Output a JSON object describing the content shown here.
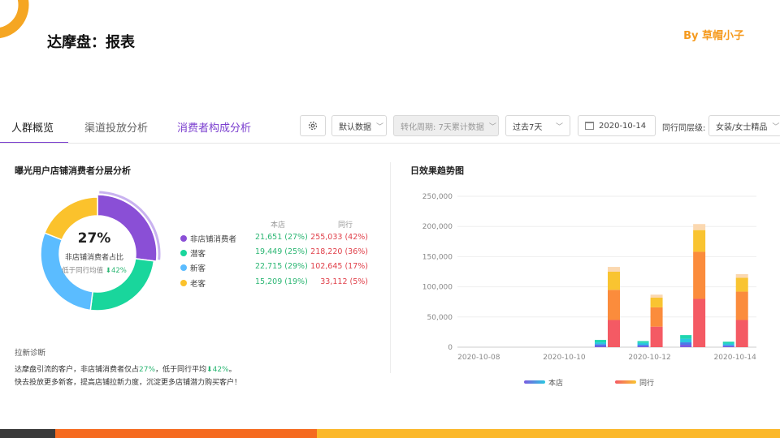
{
  "slide": {
    "title": "达摩盘：报表",
    "byline": "By 草帽小子"
  },
  "tabs": [
    {
      "label": "人群概览",
      "active": true
    },
    {
      "label": "渠道投放分析",
      "active": false
    },
    {
      "label": "消费者构成分析",
      "active": false
    }
  ],
  "toolbar": {
    "settings_icon": "gear-icon",
    "data_source": "默认数据",
    "conversion_period": "转化周期: 7天累计数据",
    "range": "过去7天",
    "date": "2020-10-14",
    "peer_label": "同行同层级:",
    "peer_category": "女装/女士精品"
  },
  "consumer_panel": {
    "title": "曝光用户店铺消费者分层分析",
    "center_value": "27%",
    "center_label": "非店铺消费者占比",
    "compare_text": "低于同行均值",
    "compare_value": "42%",
    "col_own": "本店",
    "col_peer": "同行",
    "rows": [
      {
        "name": "非店铺消费者",
        "own": "21,651 (27%)",
        "peer": "255,033 (42%)",
        "color": "#8a4fd6",
        "share": 27
      },
      {
        "name": "潜客",
        "own": "19,449 (25%)",
        "peer": "218,220 (36%)",
        "color": "#19d69c",
        "share": 25
      },
      {
        "name": "新客",
        "own": "22,715 (29%)",
        "peer": "102,645 (17%)",
        "color": "#5bbcff",
        "share": 29
      },
      {
        "name": "老客",
        "own": "15,209 (19%)",
        "peer": "33,112 (5%)",
        "color": "#fbc22c",
        "share": 19
      }
    ],
    "diagnosis_title": "拉新诊断",
    "diagnosis_line1_a": "达摩盘引流的客户，非店铺消费者仅占",
    "diagnosis_line1_b": "27%",
    "diagnosis_line1_c": "，低于同行平均",
    "diagnosis_line1_d": "42%",
    "diagnosis_line1_e": "。",
    "diagnosis_line2": "快去投放更多新客，提高店铺拉新力度，沉淀更多店铺潜力购买客户！"
  },
  "chart_data": {
    "type": "bar",
    "title": "日效果趋势图",
    "x": [
      "2020-10-08",
      "2020-10-09",
      "2020-10-10",
      "2020-10-11",
      "2020-10-12",
      "2020-10-13",
      "2020-10-14"
    ],
    "x_tick_labels": [
      "2020-10-08",
      "2020-10-10",
      "2020-10-12",
      "2020-10-14"
    ],
    "ylim": [
      0,
      250000
    ],
    "yticks": [
      "0",
      "50,000",
      "100,000",
      "150,000",
      "200,000",
      "250,000"
    ],
    "ytick_values": [
      0,
      50000,
      100000,
      150000,
      200000,
      250000
    ],
    "grid": true,
    "legend_position": "bottom",
    "series": [
      {
        "name": "本店",
        "stack_colors": [
          "#7a5be0",
          "#4a7be8",
          "#2ac7e0",
          "#1fd6b0"
        ],
        "segments": [
          [
            0,
            0,
            0,
            0
          ],
          [
            0,
            0,
            0,
            0
          ],
          [
            0,
            0,
            0,
            0
          ],
          [
            2000,
            3000,
            3000,
            4000
          ],
          [
            1500,
            2500,
            3000,
            3000
          ],
          [
            4000,
            4000,
            6000,
            6000
          ],
          [
            1500,
            2000,
            2500,
            3000
          ]
        ]
      },
      {
        "name": "同行",
        "stack_colors": [
          "#f45a64",
          "#fb8c3c",
          "#f9c431",
          "#fbd8b0"
        ],
        "segments": [
          [
            0,
            0,
            0,
            0
          ],
          [
            0,
            0,
            0,
            0
          ],
          [
            0,
            0,
            0,
            0
          ],
          [
            45000,
            50000,
            30000,
            8000
          ],
          [
            34000,
            32000,
            16000,
            5000
          ],
          [
            80000,
            78000,
            36000,
            10000
          ],
          [
            45000,
            47000,
            23000,
            6000
          ]
        ]
      }
    ]
  },
  "colors": {
    "accent": "#7b3fcf",
    "brand_orange": "#f59a1e",
    "positive_green": "#2bb673",
    "peer_red": "#e0404a"
  }
}
